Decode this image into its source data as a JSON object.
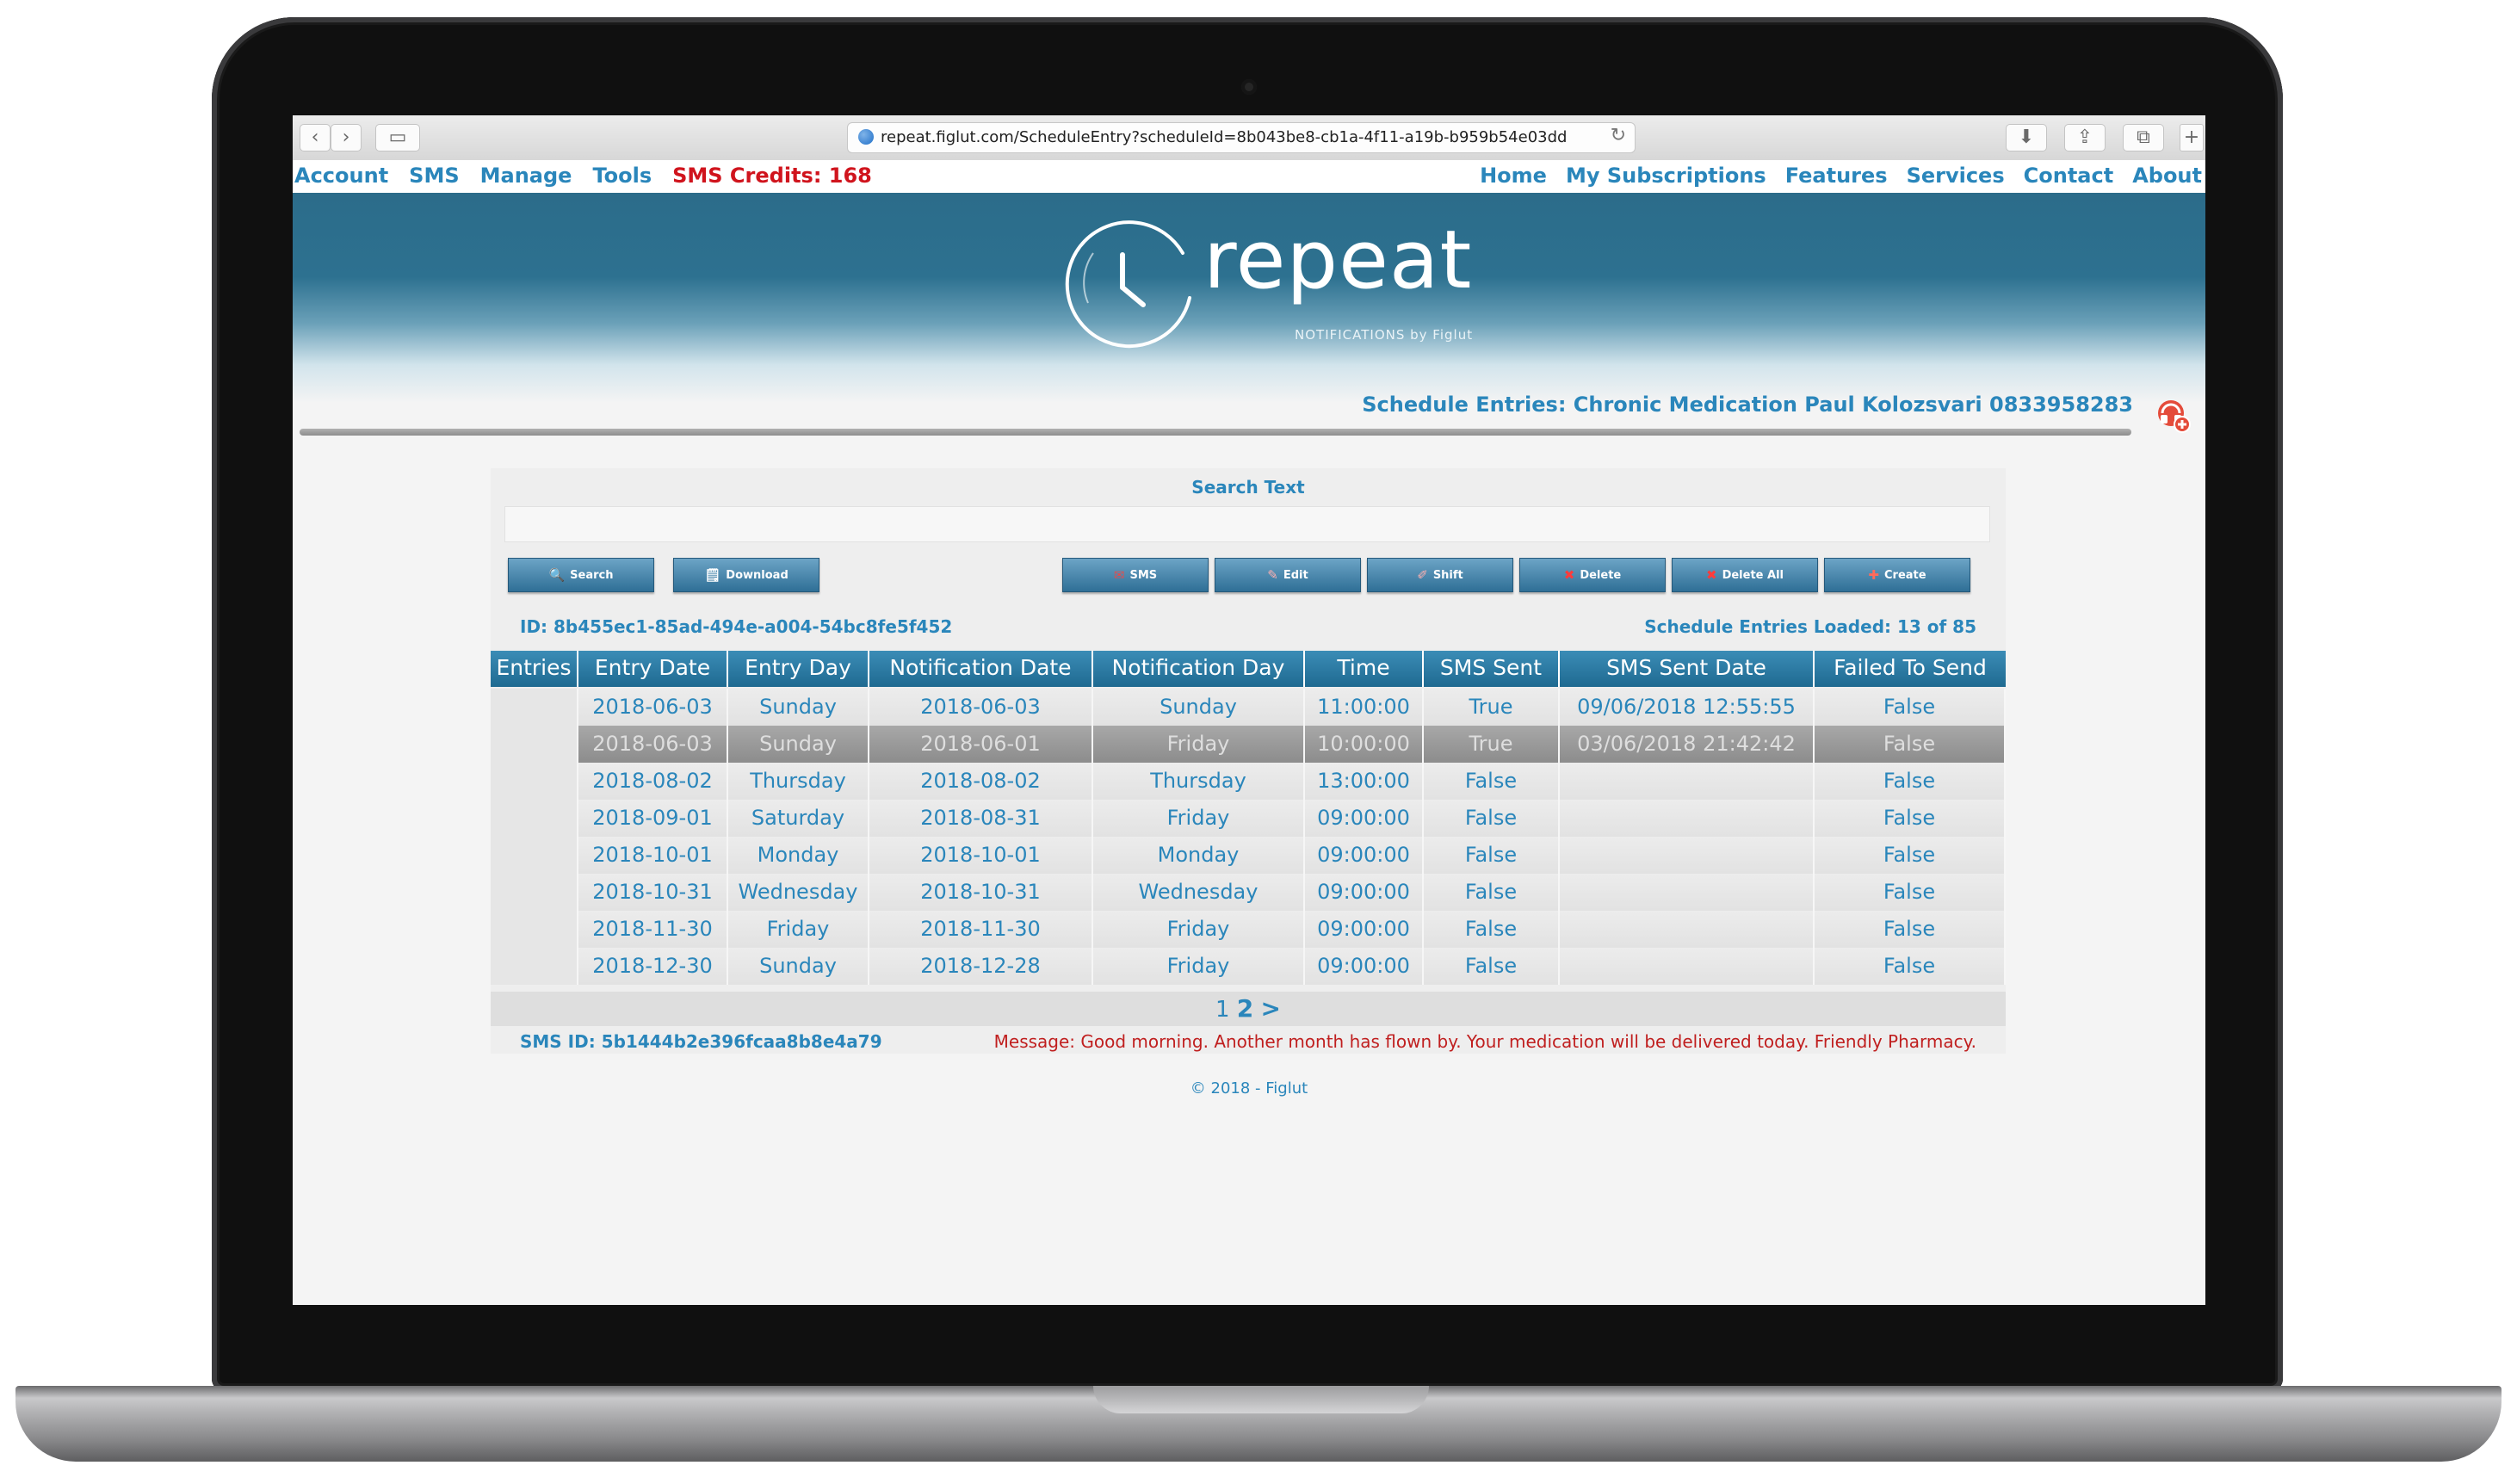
{
  "browser": {
    "url": "repeat.figlut.com/ScheduleEntry?scheduleId=8b043be8-cb1a-4f11-a19b-b959b54e03dd"
  },
  "nav": {
    "left": [
      "Account",
      "SMS",
      "Manage",
      "Tools"
    ],
    "credits": "SMS Credits: 168",
    "right": [
      "Home",
      "My Subscriptions",
      "Features",
      "Services",
      "Contact",
      "About"
    ]
  },
  "logo": {
    "name": "repeat",
    "tagline": "NOTIFICATIONS by Figlut"
  },
  "heading": "Schedule Entries: Chronic Medication Paul Kolozsvari 0833958283",
  "search": {
    "label": "Search Text",
    "value": ""
  },
  "buttons": {
    "search": "Search",
    "download": "Download",
    "sms": "SMS",
    "edit": "Edit",
    "shift": "Shift",
    "delete": "Delete",
    "delete_all": "Delete All",
    "create": "Create"
  },
  "info": {
    "id_label": "ID: 8b455ec1-85ad-494e-a004-54bc8fe5f452",
    "loaded_label": "Schedule Entries Loaded: 13 of 85"
  },
  "table": {
    "headers": [
      "Entries",
      "Entry Date",
      "Entry Day",
      "Notification Date",
      "Notification Day",
      "Time",
      "SMS Sent",
      "SMS Sent Date",
      "Failed To Send"
    ],
    "rows": [
      [
        "",
        "2018-06-03",
        "Sunday",
        "2018-06-03",
        "Sunday",
        "11:00:00",
        "True",
        "09/06/2018 12:55:55",
        "False"
      ],
      [
        "",
        "2018-06-03",
        "Sunday",
        "2018-06-01",
        "Friday",
        "10:00:00",
        "True",
        "03/06/2018 21:42:42",
        "False"
      ],
      [
        "",
        "2018-08-02",
        "Thursday",
        "2018-08-02",
        "Thursday",
        "13:00:00",
        "False",
        "",
        "False"
      ],
      [
        "",
        "2018-09-01",
        "Saturday",
        "2018-08-31",
        "Friday",
        "09:00:00",
        "False",
        "",
        "False"
      ],
      [
        "",
        "2018-10-01",
        "Monday",
        "2018-10-01",
        "Monday",
        "09:00:00",
        "False",
        "",
        "False"
      ],
      [
        "",
        "2018-10-31",
        "Wednesday",
        "2018-10-31",
        "Wednesday",
        "09:00:00",
        "False",
        "",
        "False"
      ],
      [
        "",
        "2018-11-30",
        "Friday",
        "2018-11-30",
        "Friday",
        "09:00:00",
        "False",
        "",
        "False"
      ],
      [
        "",
        "2018-12-30",
        "Sunday",
        "2018-12-28",
        "Friday",
        "09:00:00",
        "False",
        "",
        "False"
      ]
    ],
    "selected_row": 1
  },
  "pager": {
    "page1": "1",
    "page2": "2",
    "next": ">"
  },
  "sms": {
    "id_label": "SMS ID: 5b1444b2e396fcaa8b8e4a79",
    "message": "Message: Good morning. Another month has flown by. Your medication will be delivered today. Friendly Pharmacy."
  },
  "footer": "© 2018 - Figlut",
  "colors": {
    "accent": "#2a86bb",
    "credits": "#d0141d",
    "banner": "#2c6c8a",
    "message": "#c01f1f"
  }
}
